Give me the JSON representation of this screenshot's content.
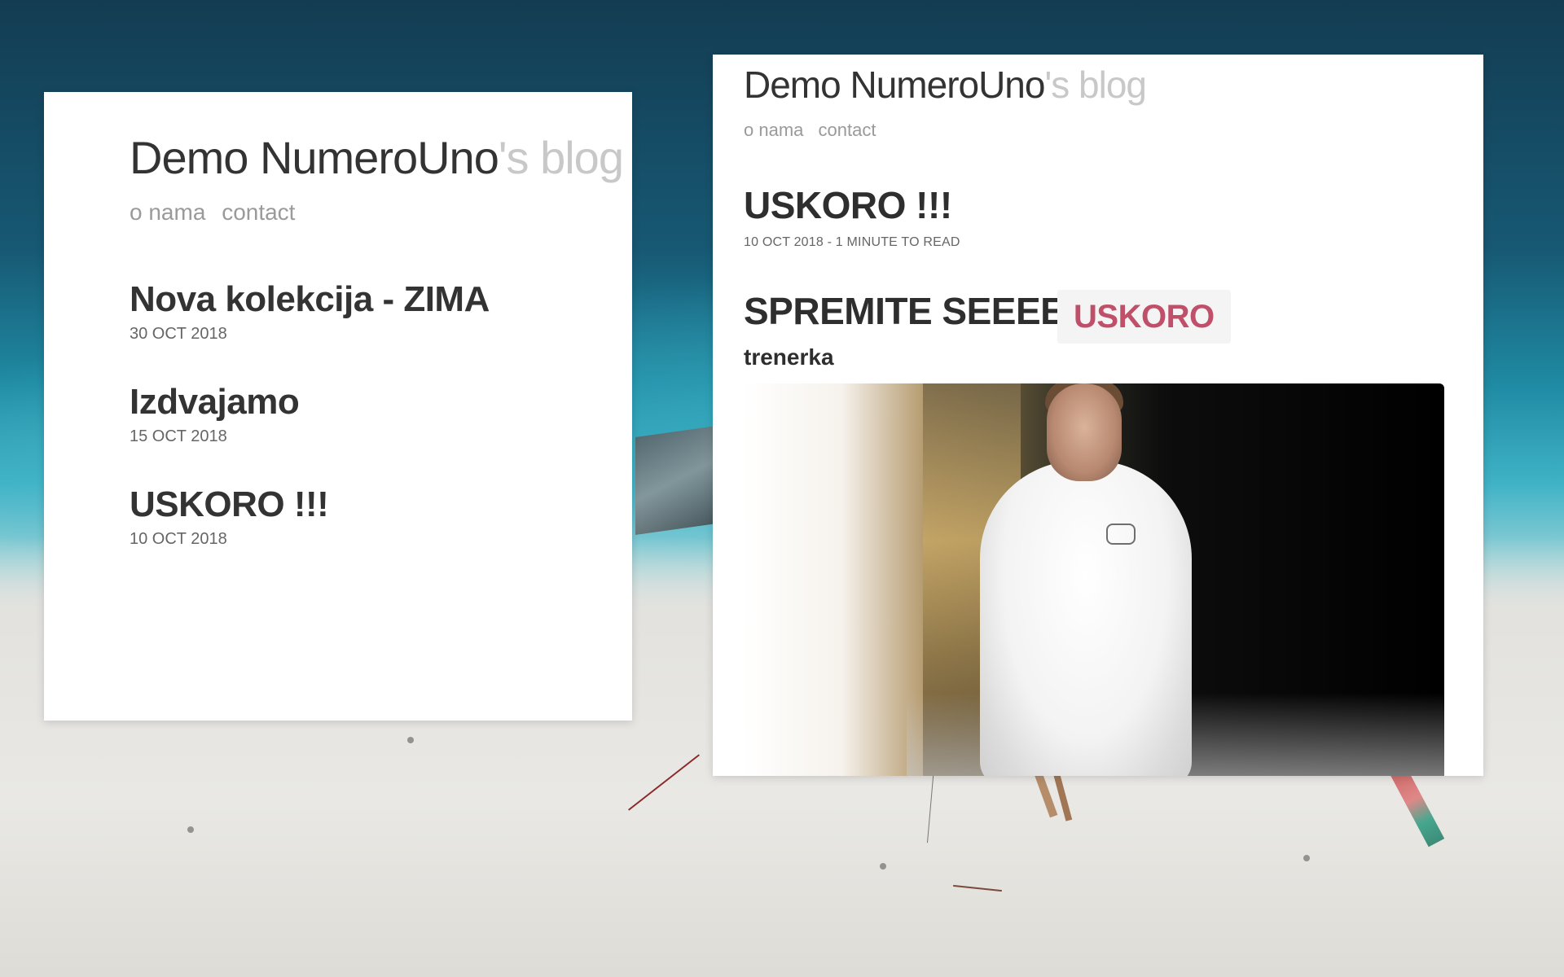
{
  "blog": {
    "title_main": "Demo NumeroUno",
    "title_suffix": "'s blog",
    "nav": [
      "o nama",
      "contact"
    ]
  },
  "left_panel": {
    "posts": [
      {
        "title": "Nova kolekcija - ZIMA",
        "date": "30 OCT 2018"
      },
      {
        "title": "Izdvajamo",
        "date": "15 OCT 2018"
      },
      {
        "title": "USKORO !!!",
        "date": "10 OCT 2018"
      }
    ]
  },
  "right_panel": {
    "article": {
      "title": "USKORO !!!",
      "meta": "10 OCT 2018 - 1 MINUTE TO READ",
      "headline": "SPREMITE SEEEEE,",
      "tag": "USKORO",
      "subhead": "trenerka"
    }
  },
  "colors": {
    "text_dark": "#333333",
    "title_suffix": "#c8c8c8",
    "nav_link": "#9a9a9a",
    "tag_text": "#c0506a",
    "tag_bg": "#f4f4f4"
  }
}
